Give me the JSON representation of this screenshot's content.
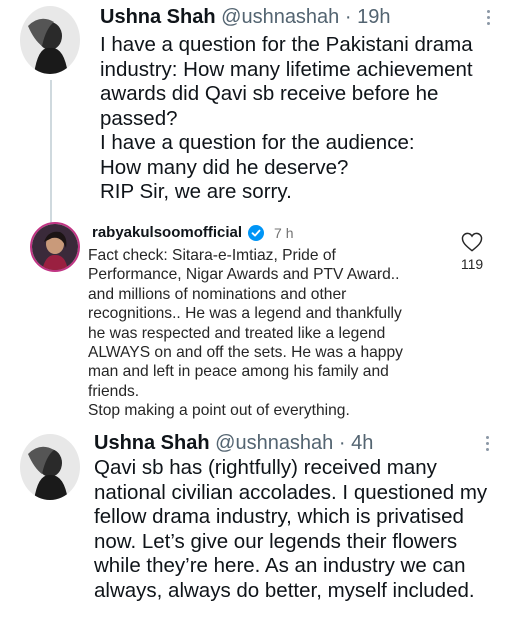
{
  "tweet1": {
    "name": "Ushna Shah",
    "handle": "@ushnashah",
    "time": "· 19h",
    "lines": [
      "I have a question for the Pakistani drama",
      "industry: How many lifetime achievement",
      "awards did Qavi sb receive before he",
      "passed?",
      "I have a question for the audience:",
      "How many did he deserve?",
      "RIP Sir, we are sorry."
    ]
  },
  "comment": {
    "username": "rabyakulsoomofficial",
    "time": "7 h",
    "likes": "119",
    "lines": [
      "Fact check: Sitara-e-Imtiaz, Pride of",
      "Performance, Nigar Awards and PTV Award..",
      "and millions of nominations and other",
      "recognitions.. He was a legend and thankfully",
      "he was respected and treated like a legend",
      "ALWAYS on and off the sets. He was a happy",
      "man and left in peace among his family and",
      "friends.",
      "Stop making a point out of everything."
    ]
  },
  "tweet2": {
    "name": "Ushna Shah",
    "handle": "@ushnashah",
    "time": "· 4h",
    "lines": [
      "Qavi sb has (rightfully) received many",
      "national civilian accolades. I questioned my",
      "fellow drama industry, which is privatised",
      "now. Let’s give our legends their flowers",
      "while they’re here. As an industry we can",
      "always, always do better, myself included."
    ]
  },
  "colors": {
    "thread_line": "#cfd9de",
    "verified": "#0095f6",
    "comment_avatar_ring": "#c13584"
  }
}
